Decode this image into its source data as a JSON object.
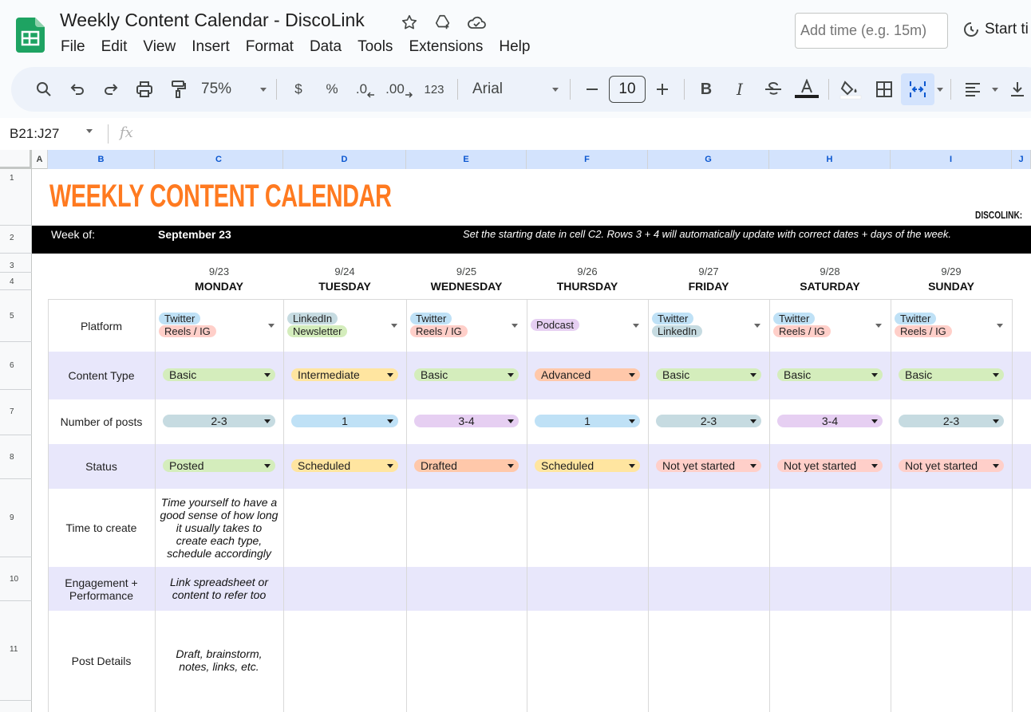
{
  "app": {
    "doc_title": "Weekly Content Calendar - DiscoLink",
    "menu": [
      "File",
      "Edit",
      "View",
      "Insert",
      "Format",
      "Data",
      "Tools",
      "Extensions",
      "Help"
    ],
    "time_placeholder": "Add time (e.g. 15m)",
    "start_timer": "Start ti"
  },
  "toolbar": {
    "zoom": "75%",
    "currency": "$",
    "percent": "%",
    "decrease_decimal": ".0",
    "increase_decimal": ".00",
    "number_format": "123",
    "font": "Arial",
    "font_size": "10",
    "bold": "B",
    "italic": "I"
  },
  "formula": {
    "namebox": "B21:J27",
    "fx": "fx"
  },
  "columns": [
    "A",
    "B",
    "C",
    "D",
    "E",
    "F",
    "G",
    "H",
    "I",
    "J"
  ],
  "rows": [
    "1",
    "2",
    "3",
    "4",
    "5",
    "6",
    "7",
    "8",
    "9",
    "10",
    "11"
  ],
  "sheet": {
    "title": "WEEKLY CONTENT CALENDAR",
    "brand": "DISCOLINK:",
    "week_label": "Week of:",
    "week_value": "September 23",
    "note": "Set the starting date in cell C2. Rows 3 + 4 will automatically update with correct dates + days of the week.",
    "labels": {
      "platform": "Platform",
      "content_type": "Content Type",
      "posts": "Number of posts",
      "status": "Status",
      "time": "Time to create",
      "engagement_1": "Engagement +",
      "engagement_2": "Performance",
      "details": "Post Details"
    },
    "days": [
      {
        "date": "9/23",
        "name": "MONDAY",
        "platforms": [
          "Twitter",
          "Reels / IG"
        ],
        "type": "Basic",
        "posts": "2-3",
        "status": "Posted"
      },
      {
        "date": "9/24",
        "name": "TUESDAY",
        "platforms": [
          "LinkedIn",
          "Newsletter"
        ],
        "type": "Intermediate",
        "posts": "1",
        "status": "Scheduled"
      },
      {
        "date": "9/25",
        "name": "WEDNESDAY",
        "platforms": [
          "Twitter",
          "Reels / IG"
        ],
        "type": "Basic",
        "posts": "3-4",
        "status": "Drafted"
      },
      {
        "date": "9/26",
        "name": "THURSDAY",
        "platforms": [
          "Podcast"
        ],
        "type": "Advanced",
        "posts": "1",
        "status": "Scheduled"
      },
      {
        "date": "9/27",
        "name": "FRIDAY",
        "platforms": [
          "Twitter",
          "LinkedIn"
        ],
        "type": "Basic",
        "posts": "2-3",
        "status": "Not yet started"
      },
      {
        "date": "9/28",
        "name": "SATURDAY",
        "platforms": [
          "Twitter",
          "Reels / IG"
        ],
        "type": "Basic",
        "posts": "3-4",
        "status": "Not yet started"
      },
      {
        "date": "9/29",
        "name": "SUNDAY",
        "platforms": [
          "Twitter",
          "Reels / IG"
        ],
        "type": "Basic",
        "posts": "2-3",
        "status": "Not yet started"
      }
    ],
    "notes": {
      "time": [
        "Time yourself to have a",
        "good sense of how long",
        "it usually takes to",
        "create each type,",
        "schedule accordingly"
      ],
      "engagement": [
        "Link spreadsheet or",
        "content to refer too"
      ],
      "details": [
        "Draft, brainstorm,",
        "notes, links, etc."
      ]
    }
  },
  "colors": {
    "Twitter": "#bfe1f6",
    "Reels / IG": "#ffcfc9",
    "LinkedIn": "#c6dbe1",
    "Newsletter": "#d4edbc",
    "Podcast": "#e6cff2",
    "Basic": "#d4edbc",
    "Intermediate": "#ffe5a0",
    "Advanced": "#ffc8aa",
    "2-3": "#c6dbe1",
    "1": "#bfe1f6",
    "3-4": "#e6cff2",
    "Posted": "#d4edbc",
    "Scheduled": "#ffe5a0",
    "Drafted": "#ffc8aa",
    "Not yet started": "#ffcfc9"
  }
}
